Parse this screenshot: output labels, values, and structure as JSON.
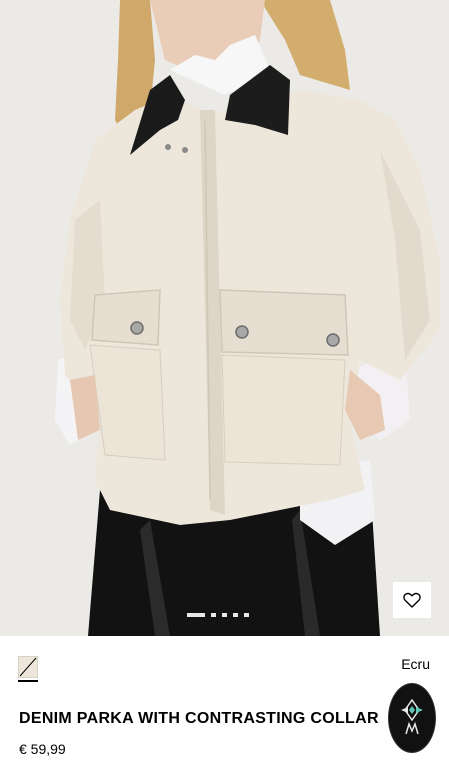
{
  "product": {
    "title": "DENIM PARKA WITH CONTRASTING COLLAR",
    "price": "€ 59,99",
    "color_name": "Ecru"
  },
  "gallery": {
    "image_count": 5,
    "active_index": 0
  },
  "icons": {
    "wishlist": "heart-icon",
    "swatch": "color-swatch-icon",
    "assistant": "assistant-logo-icon"
  },
  "colors": {
    "background": "#eceae6",
    "jacket": "#ede7db",
    "collar": "#1a1a1a",
    "trousers": "#121212"
  }
}
